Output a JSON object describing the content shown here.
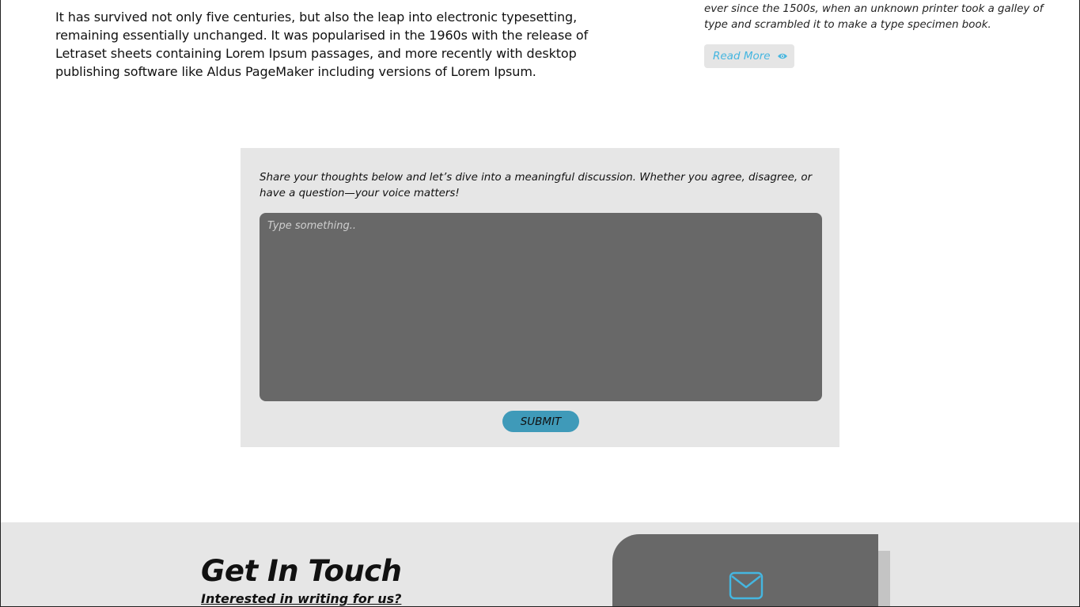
{
  "article": {
    "paragraph": "It has survived not only five centuries, but also the leap into electronic typesetting, remaining essentially unchanged. It was popularised in the 1960s with the release of Letraset sheets containing Lorem Ipsum passages, and more recently with desktop publishing software like Aldus PageMaker including versions of Lorem Ipsum."
  },
  "side_post": {
    "excerpt": "ever since the 1500s, when an unknown printer took a galley of type and scrambled it to make a type specimen book.",
    "read_more_label": "Read More",
    "read_more_icon": "eye-icon"
  },
  "comment": {
    "prompt": "Share your thoughts below and let’s dive into a meaningful discussion. Whether you agree, disagree, or have a question—your voice matters!",
    "placeholder": "Type something..",
    "value": "",
    "submit_label": "SUBMIT"
  },
  "contact": {
    "title": "Get In Touch",
    "subtitle": "Interested in writing for us?",
    "card_icon": "mail-icon"
  },
  "colors": {
    "accent": "#3f9ab9",
    "link": "#45b6e0",
    "panel": "#e6e6e6",
    "input": "#686868"
  }
}
